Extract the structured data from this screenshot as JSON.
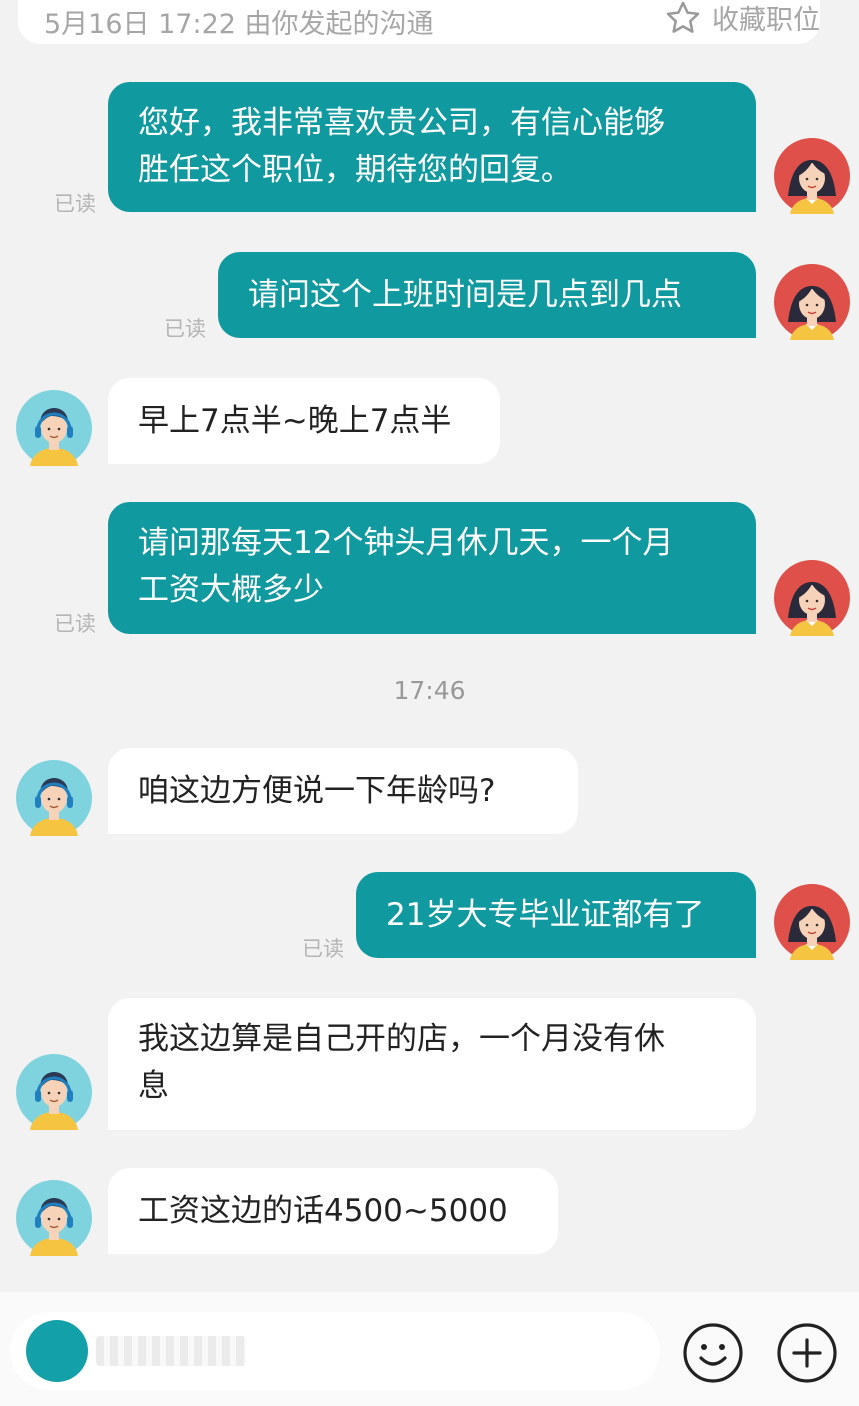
{
  "header": {
    "left_text": "5月16日 17:22 由你发起的沟通",
    "favorite_label": "收藏职位"
  },
  "messages": [
    {
      "side": "me",
      "lines": [
        "您好，我非常喜欢贵公司，有信心能够",
        "胜任这个职位，期待您的回复。"
      ],
      "read": "已读"
    },
    {
      "side": "me",
      "text": "请问这个上班时间是几点到几点",
      "read": "已读"
    },
    {
      "side": "them",
      "text": "早上7点半~晚上7点半"
    },
    {
      "side": "me",
      "lines": [
        "请问那每天12个钟头月休几天，一个月",
        "工资大概多少"
      ],
      "read": "已读"
    },
    {
      "side": "them",
      "text": "咱这边方便说一下年龄吗?"
    },
    {
      "side": "me",
      "text": "21岁大专毕业证都有了",
      "read": "已读"
    },
    {
      "side": "them",
      "lines": [
        "我这边算是自己开的店，一个月没有休",
        "息"
      ]
    },
    {
      "side": "them",
      "text": "工资这边的话4500~5000"
    }
  ],
  "time_divider": "17:46",
  "icons": {
    "favorite": "star-outline-icon",
    "emoji": "smiley-icon",
    "more": "plus-circle-icon",
    "my_avatar": "female-avatar",
    "their_avatar": "male-avatar-headset"
  },
  "colors": {
    "my_bubble": "#109aa0",
    "their_bubble": "#ffffff",
    "background": "#f2f2f2"
  }
}
